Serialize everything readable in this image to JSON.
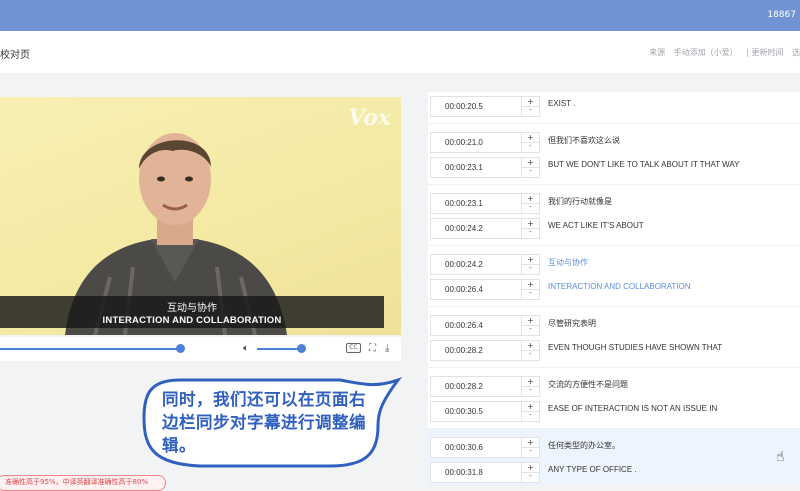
{
  "header": {
    "user": "18867"
  },
  "titlebar": {
    "title": "校对页",
    "meta": [
      "来源",
      "手动添加（小爱）",
      "| 更新时间",
      "选"
    ]
  },
  "video": {
    "logo": "Vox",
    "subtitle_zh": "互动与协作",
    "subtitle_en": "INTERACTION AND COLLABORATION"
  },
  "controls": {
    "cc_label": "CC",
    "volume_icon": "speaker-icon",
    "fullscreen_icon": "fullscreen-icon",
    "download_icon": "download-icon"
  },
  "bubble": {
    "text": "同时，我们还可以在页面右边栏同步对字幕进行调整编辑。"
  },
  "notice": {
    "text": "准确性高于95%，中译英翻译准确性高于80%"
  },
  "subtitles": [
    {
      "time": "00:00:20.5",
      "text": "EXIST .",
      "active": false
    },
    {
      "time": "00:00:21.0",
      "text": "但我们不喜欢这么说",
      "active": false
    },
    {
      "time": "00:00:23.1",
      "text": "BUT WE DON'T LIKE TO TALK ABOUT IT THAT WAY",
      "active": false
    },
    {
      "time": "00:00:23.1",
      "text": "我们的行动就像是",
      "active": false
    },
    {
      "time": "00:00:24.2",
      "text": "WE ACT LIKE IT'S ABOUT",
      "active": false
    },
    {
      "time": "00:00:24.2",
      "text": "互动与协作",
      "active": true
    },
    {
      "time": "00:00:26.4",
      "text": "INTERACTION AND COLLABORATION",
      "active": true
    },
    {
      "time": "00:00:26.4",
      "text": "尽管研究表明",
      "active": false
    },
    {
      "time": "00:00:28.2",
      "text": "EVEN THOUGH STUDIES HAVE SHOWN THAT",
      "active": false
    },
    {
      "time": "00:00:28.2",
      "text": "交流的方便性不是问题",
      "active": false
    },
    {
      "time": "00:00:30.5",
      "text": "EASE OF INTERACTION IS NOT AN ISSUE IN",
      "active": false
    },
    {
      "time": "00:00:30.6",
      "text": "任何类型的办公室。",
      "active": false
    },
    {
      "time": "00:00:31.8",
      "text": "ANY TYPE OF OFFICE .",
      "active": false
    }
  ],
  "colors": {
    "topbar": "#6f93d3",
    "accent": "#4a7fd6",
    "active_text": "#5b8de0",
    "bubble_text": "#2f5fbf"
  }
}
